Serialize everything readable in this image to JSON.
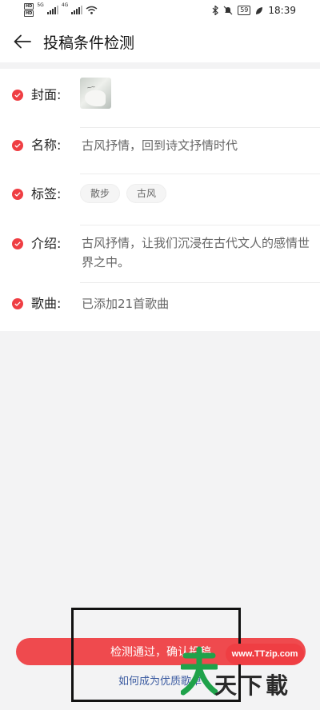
{
  "status_bar": {
    "hd_labels": [
      "HD",
      "HD"
    ],
    "net_labels": [
      "5G",
      "4G"
    ],
    "battery": "59",
    "time": "18:39",
    "icons": [
      "signal-icon",
      "wifi-icon",
      "bluetooth-icon",
      "mute-icon",
      "battery-icon",
      "leaf-icon"
    ]
  },
  "header": {
    "back_icon": "arrow-left-icon",
    "title": "投稿条件检测"
  },
  "rows": {
    "cover": {
      "label": "封面:"
    },
    "name": {
      "label": "名称:",
      "value": "古风抒情，回到诗文抒情时代"
    },
    "tags": {
      "label": "标签:",
      "items": [
        "散步",
        "古风"
      ]
    },
    "intro": {
      "label": "介绍:",
      "value": "古风抒情，让我们沉浸在古代文人的感情世界之中。"
    },
    "songs": {
      "label": "歌曲:",
      "value": "已添加21首歌曲"
    }
  },
  "bottom": {
    "confirm_label": "检测通过，确认投稿",
    "help_label": "如何成为优质歌单"
  },
  "watermark": {
    "url": "www.TTzip.com",
    "text": "天下載"
  },
  "colors": {
    "accent": "#ef3e43",
    "button": "#ef4a4e",
    "link": "#3a5aa0",
    "background": "#f3f3f4"
  }
}
